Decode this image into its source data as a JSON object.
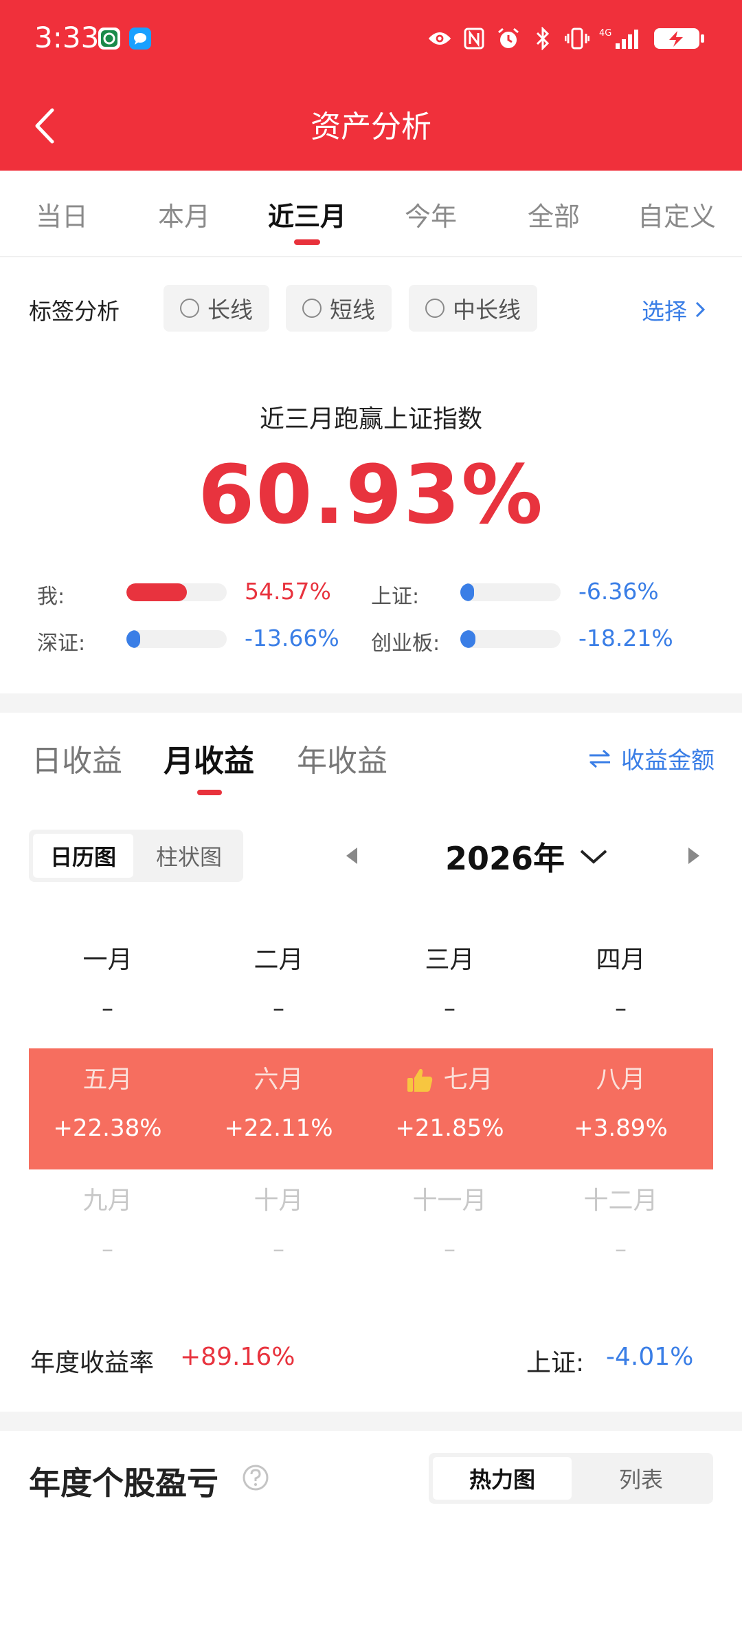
{
  "status_bar": {
    "time": "3:33",
    "left_icons": [
      "bank-app-icon",
      "message-app-icon"
    ],
    "right_icons": [
      "eye-icon",
      "nfc-icon",
      "alarm-icon",
      "bluetooth-icon",
      "vibrate-icon",
      "signal-4g-icon",
      "battery-charging-icon"
    ],
    "network": "4G"
  },
  "header": {
    "title": "资产分析",
    "back_icon": "back-chevron-icon"
  },
  "period_tabs": {
    "items": [
      "当日",
      "本月",
      "近三月",
      "今年",
      "全部",
      "自定义"
    ],
    "active_index": 2
  },
  "tag_filter": {
    "label": "标签分析",
    "chips": [
      "长线",
      "短线",
      "中长线"
    ],
    "select_label": "选择"
  },
  "beat_index": {
    "title": "近三月跑赢上证指数",
    "value": "60.93%",
    "comparisons": [
      {
        "label": "我:",
        "value": "54.57%",
        "color": "#e8333e",
        "level": 0.6
      },
      {
        "label": "上证:",
        "value": "-6.36%",
        "color": "#3a7ee6",
        "level": 0.05
      },
      {
        "label": "深证:",
        "value": "-13.66%",
        "color": "#3a7ee6",
        "level": 0.1
      },
      {
        "label": "创业板:",
        "value": "-18.21%",
        "color": "#3a7ee6",
        "level": 0.15
      }
    ]
  },
  "earnings": {
    "tabs": [
      "日收益",
      "月收益",
      "年收益"
    ],
    "active_index": 1,
    "toggle_label": "收益金额",
    "view_options": [
      "日历图",
      "柱状图"
    ],
    "active_view": 0,
    "year": "2026年",
    "months": [
      {
        "name": "一月",
        "value": "–",
        "state": "empty"
      },
      {
        "name": "二月",
        "value": "–",
        "state": "empty"
      },
      {
        "name": "三月",
        "value": "–",
        "state": "empty"
      },
      {
        "name": "四月",
        "value": "–",
        "state": "empty"
      },
      {
        "name": "五月",
        "value": "+22.38%",
        "state": "hot"
      },
      {
        "name": "六月",
        "value": "+22.11%",
        "state": "hot"
      },
      {
        "name": "七月",
        "value": "+21.85%",
        "state": "hot",
        "best": true
      },
      {
        "name": "八月",
        "value": "+3.89%",
        "state": "hot"
      },
      {
        "name": "九月",
        "value": "–",
        "state": "future"
      },
      {
        "name": "十月",
        "value": "–",
        "state": "future"
      },
      {
        "name": "十一月",
        "value": "–",
        "state": "future"
      },
      {
        "name": "十二月",
        "value": "–",
        "state": "future"
      }
    ],
    "annual_label": "年度收益率",
    "annual_value": "+89.16%",
    "sh_label": "上证:",
    "sh_value": "-4.01%"
  },
  "stock_pnl": {
    "title": "年度个股盈亏",
    "options": [
      "热力图",
      "列表"
    ],
    "active_index": 0
  }
}
